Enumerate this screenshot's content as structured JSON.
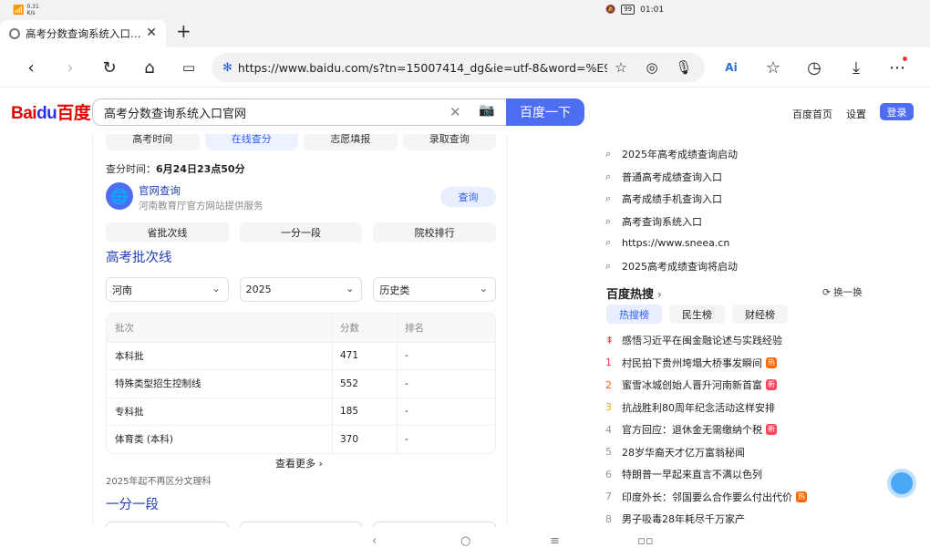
{
  "status": {
    "speed_value": "0.31",
    "speed_unit": "K/s",
    "battery": "99",
    "time": "01:01"
  },
  "tab": {
    "title": "高考分数查询系统入口…",
    "close_icon": "close-icon"
  },
  "toolbar": {
    "url": "https://www.baidu.com/s?tn=15007414_dg&ie=utf-8&word=%E9%AB…",
    "icons": [
      "back-icon",
      "forward-icon",
      "reload-icon",
      "home-icon",
      "screen-icon",
      "star-icon",
      "camera-icon",
      "mic-icon",
      "ai-icon",
      "favorites-icon",
      "history-icon",
      "download-icon",
      "more-icon"
    ]
  },
  "header": {
    "logo_bai": "Bai",
    "logo_du": "du",
    "logo_cn": "百度",
    "query": "高考分数查询系统入口官网",
    "search_button": "百度一下",
    "home_link": "百度首页",
    "settings_link": "设置",
    "login_button": "登录"
  },
  "result": {
    "top_tabs": [
      "高考时间",
      "在线查分",
      "志愿填报",
      "录取查询"
    ],
    "query_time_label": "查分时间：",
    "query_time_value": "6月24日23点50分",
    "official_title": "官网查询",
    "official_sub": "河南教育厅官方网站提供服务",
    "query_button": "查询",
    "pills": [
      "省批次线",
      "一分一段",
      "院校排行"
    ],
    "section_title": "高考批次线",
    "selects": {
      "province": "河南",
      "year": "2025",
      "category": "历史类"
    },
    "table": {
      "headers": [
        "批次",
        "分数",
        "排名"
      ],
      "rows": [
        [
          "本科批",
          "471",
          "-"
        ],
        [
          "特殊类型招生控制线",
          "552",
          "-"
        ],
        [
          "专科批",
          "185",
          "-"
        ],
        [
          "体育类 (本科)",
          "370",
          "-"
        ]
      ]
    },
    "more_link": "查看更多 ›",
    "note": "2025年起不再区分文理科",
    "section2_title": "一分一段"
  },
  "sidebar": {
    "suggestions": [
      "2025年高考成绩查询启动",
      "普通高考成绩查询入口",
      "高考成绩手机查询入口",
      "高考查询系统入口",
      "https://www.sneea.cn",
      "2025高考成绩查询将启动"
    ],
    "hot_title": "百度热搜",
    "refresh": "换一换",
    "hot_tabs": [
      "热搜榜",
      "民生榜",
      "财经榜"
    ],
    "hot_items": [
      {
        "rank": "⇞",
        "text": "感悟习近平在闽金融论述与实践经验",
        "tag": ""
      },
      {
        "rank": "1",
        "text": "村民拍下贵州垮塌大桥事发瞬间",
        "tag": "热"
      },
      {
        "rank": "2",
        "text": "蜜雪冰城创始人晋升河南新首富",
        "tag": "新"
      },
      {
        "rank": "3",
        "text": "抗战胜利80周年纪念活动这样安排",
        "tag": ""
      },
      {
        "rank": "4",
        "text": "官方回应：退休金无需缴纳个税",
        "tag": "新"
      },
      {
        "rank": "5",
        "text": "28岁华裔天才亿万富翁秘闻",
        "tag": ""
      },
      {
        "rank": "6",
        "text": "特朗普一早起来直言不满以色列",
        "tag": ""
      },
      {
        "rank": "7",
        "text": "印度外长：邻国要么合作要么付出代价",
        "tag": "热"
      },
      {
        "rank": "8",
        "text": "男子吸毒28年耗尽千万家产",
        "tag": ""
      }
    ],
    "rank_colors": {
      "top": "#fe2d46",
      "1": "#fe2d46",
      "2": "#f60",
      "3": "#faa90e",
      "other": "#9195a3"
    },
    "tag_colors": {
      "热": "#ff6600",
      "新": "#ff455b"
    }
  },
  "colors": {
    "accent": "#4e6ef2",
    "link": "#2440b3"
  }
}
